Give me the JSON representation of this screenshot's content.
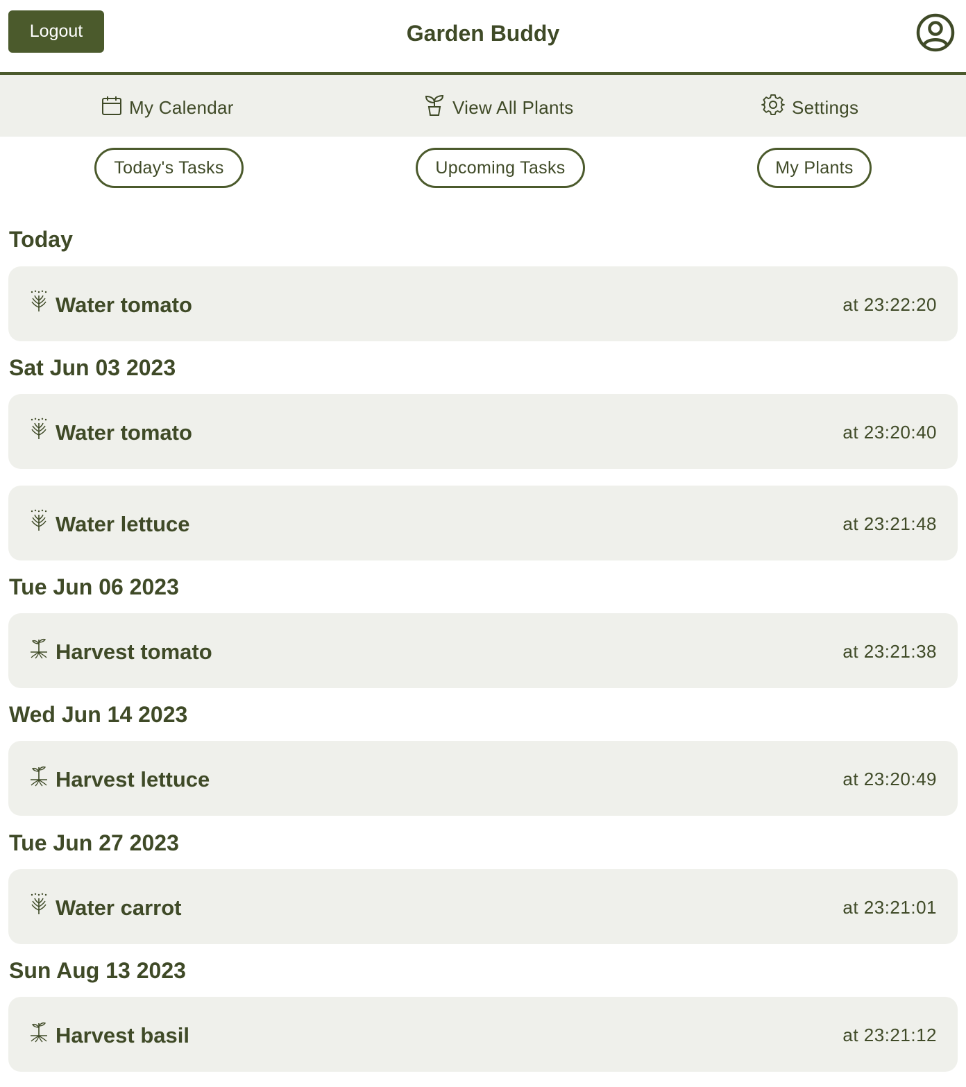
{
  "header": {
    "logout_label": "Logout",
    "app_title": "Garden Buddy",
    "avatar_icon": "user-circle-icon"
  },
  "nav": {
    "calendar_label": "My Calendar",
    "plants_label": "View All Plants",
    "settings_label": "Settings"
  },
  "tabs": {
    "today_label": "Today's Tasks",
    "upcoming_label": "Upcoming Tasks",
    "myplants_label": "My Plants"
  },
  "sections": [
    {
      "title": "Today",
      "tasks": [
        {
          "name": "Water tomato",
          "time": "at 23:22:20",
          "icon": "water-sprout-icon"
        }
      ]
    },
    {
      "title": "Sat Jun 03 2023",
      "tasks": [
        {
          "name": "Water tomato",
          "time": "at 23:20:40",
          "icon": "water-sprout-icon"
        },
        {
          "name": "Water lettuce",
          "time": "at 23:21:48",
          "icon": "water-sprout-icon"
        }
      ]
    },
    {
      "title": "Tue Jun 06 2023",
      "tasks": [
        {
          "name": "Harvest tomato",
          "time": "at 23:21:38",
          "icon": "harvest-sprout-icon"
        }
      ]
    },
    {
      "title": "Wed Jun 14 2023",
      "tasks": [
        {
          "name": "Harvest lettuce",
          "time": "at 23:20:49",
          "icon": "harvest-sprout-icon"
        }
      ]
    },
    {
      "title": "Tue Jun 27 2023",
      "tasks": [
        {
          "name": "Water carrot",
          "time": "at 23:21:01",
          "icon": "water-sprout-icon"
        }
      ]
    },
    {
      "title": "Sun Aug 13 2023",
      "tasks": [
        {
          "name": "Harvest basil",
          "time": "at 23:21:12",
          "icon": "harvest-sprout-icon"
        }
      ]
    }
  ],
  "colors": {
    "accent": "#4b5a2c",
    "text": "#3f4a27",
    "card_bg": "#eff0eb"
  }
}
